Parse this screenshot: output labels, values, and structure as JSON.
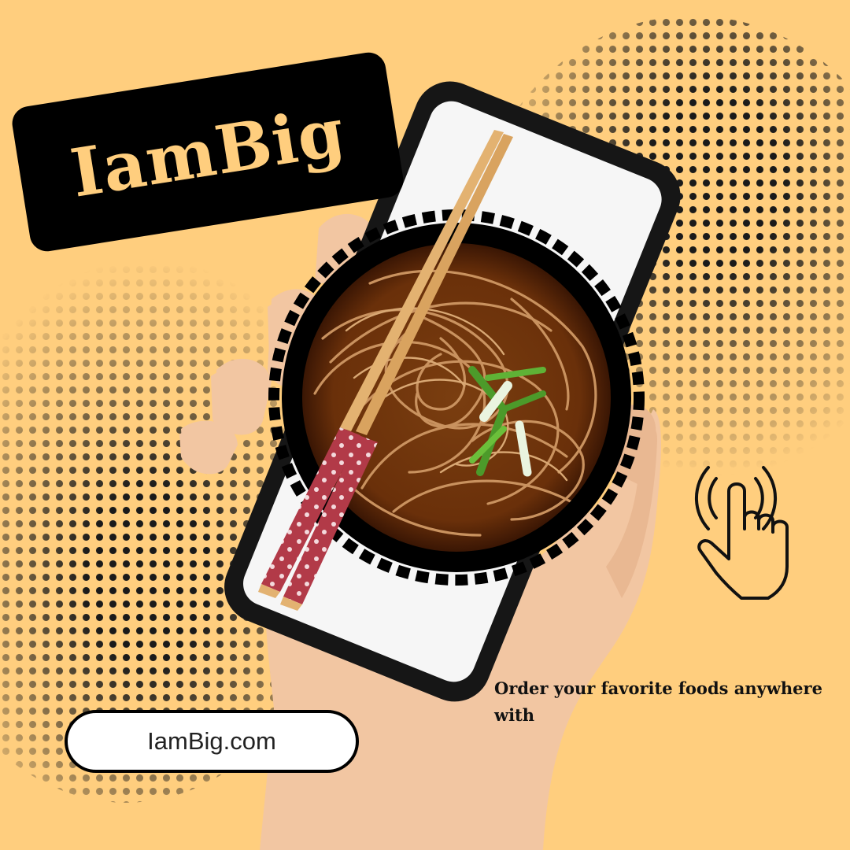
{
  "brand": {
    "name": "IamBig"
  },
  "tagline": "Order your favorite foods anywhere with",
  "cta": {
    "website": "IamBig.com"
  },
  "colors": {
    "background": "#FFCE7E",
    "ink": "#000000",
    "badge_text": "#FFCE7E",
    "chopstick_red": "#B23A48"
  },
  "icons": [
    "tap-hand-icon"
  ]
}
